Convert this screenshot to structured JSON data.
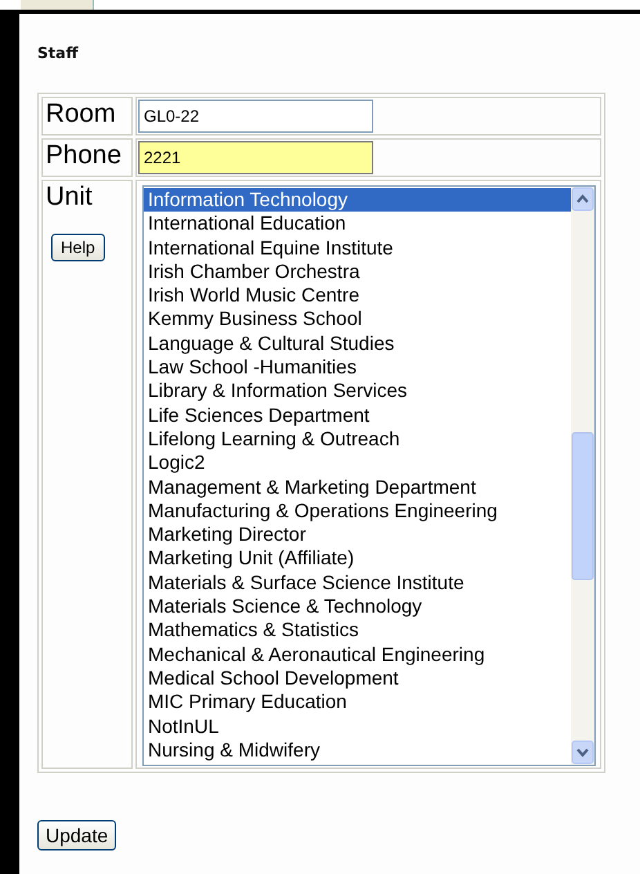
{
  "section_title": "Staff",
  "fields": [
    {
      "label": "Room",
      "value": "GL0-22",
      "autofilled": false
    },
    {
      "label": "Phone",
      "value": "2221",
      "autofilled": true
    }
  ],
  "unit": {
    "label": "Unit",
    "help_button": "Help",
    "items": [
      {
        "label": "Information Technology",
        "selected": true
      },
      {
        "label": "International Education",
        "selected": false
      },
      {
        "label": "International Equine Institute",
        "selected": false
      },
      {
        "label": "Irish Chamber Orchestra",
        "selected": false
      },
      {
        "label": "Irish World Music Centre",
        "selected": false
      },
      {
        "label": "Kemmy Business School",
        "selected": false
      },
      {
        "label": "Language & Cultural Studies",
        "selected": false
      },
      {
        "label": "Law School -Humanities",
        "selected": false
      },
      {
        "label": "Library & Information Services",
        "selected": false
      },
      {
        "label": "Life Sciences Department",
        "selected": false
      },
      {
        "label": "Lifelong Learning & Outreach",
        "selected": false
      },
      {
        "label": "Logic2",
        "selected": false
      },
      {
        "label": "Management & Marketing Department",
        "selected": false
      },
      {
        "label": "Manufacturing & Operations Engineering",
        "selected": false
      },
      {
        "label": "Marketing Director",
        "selected": false
      },
      {
        "label": "Marketing Unit (Affiliate)",
        "selected": false
      },
      {
        "label": "Materials & Surface Science Institute",
        "selected": false
      },
      {
        "label": "Materials Science & Technology",
        "selected": false
      },
      {
        "label": "Mathematics & Statistics",
        "selected": false
      },
      {
        "label": "Mechanical & Aeronautical Engineering",
        "selected": false
      },
      {
        "label": "Medical School Development",
        "selected": false
      },
      {
        "label": "MIC Primary Education",
        "selected": false
      },
      {
        "label": "NotInUL",
        "selected": false
      },
      {
        "label": "Nursing & Midwifery",
        "selected": false
      }
    ]
  },
  "update_button": "Update"
}
